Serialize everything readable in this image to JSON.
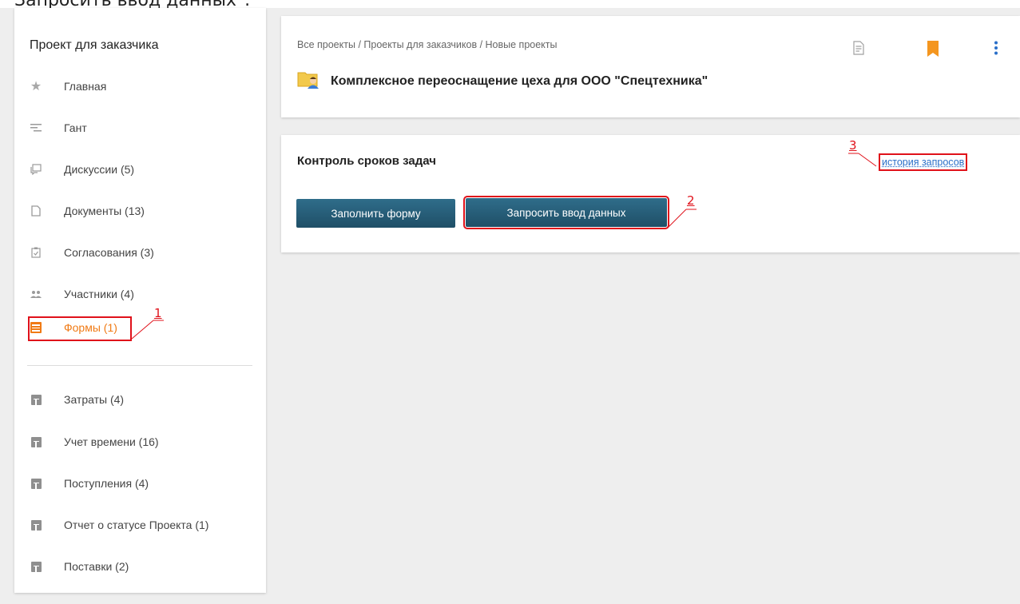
{
  "caption": "Запросить ввод данных\".",
  "sidebar": {
    "title": "Проект для заказчика",
    "items": [
      {
        "label": "Главная",
        "icon": "star-icon"
      },
      {
        "label": "Гант",
        "icon": "gantt-icon"
      },
      {
        "label": "Дискуссии (5)",
        "icon": "discussion-icon"
      },
      {
        "label": "Документы (13)",
        "icon": "document-icon"
      },
      {
        "label": "Согласования (3)",
        "icon": "approval-icon"
      },
      {
        "label": "Участники (4)",
        "icon": "participants-icon"
      },
      {
        "label": "Формы (1)",
        "icon": "forms-icon",
        "active": true
      }
    ],
    "extra_items": [
      {
        "label": "Затраты (4)",
        "icon": "table-icon"
      },
      {
        "label": "Учет времени (16)",
        "icon": "table-icon"
      },
      {
        "label": "Поступления (4)",
        "icon": "table-icon"
      },
      {
        "label": "Отчет о статусе Проекта (1)",
        "icon": "table-icon"
      },
      {
        "label": "Поставки (2)",
        "icon": "table-icon"
      }
    ]
  },
  "header": {
    "breadcrumb": [
      "Все проекты",
      "Проекты для заказчиков",
      "Новые проекты"
    ],
    "separator": " / ",
    "title": "Комплексное переоснащение цеха для ООО \"Спецтехника\"",
    "icons": [
      "document-add-icon",
      "bookmark-icon",
      "more-vertical-icon"
    ]
  },
  "form_card": {
    "title": "Контроль сроков задач",
    "history_link": "история запросов",
    "fill_button": "Заполнить форму",
    "request_button": "Запросить ввод данных"
  },
  "annotations": {
    "n1": "1",
    "n2": "2",
    "n3": "3"
  },
  "colors": {
    "accent": "#f07a14",
    "button": "#235a74",
    "link": "#2a6fc9",
    "annotation": "#e0111a"
  }
}
